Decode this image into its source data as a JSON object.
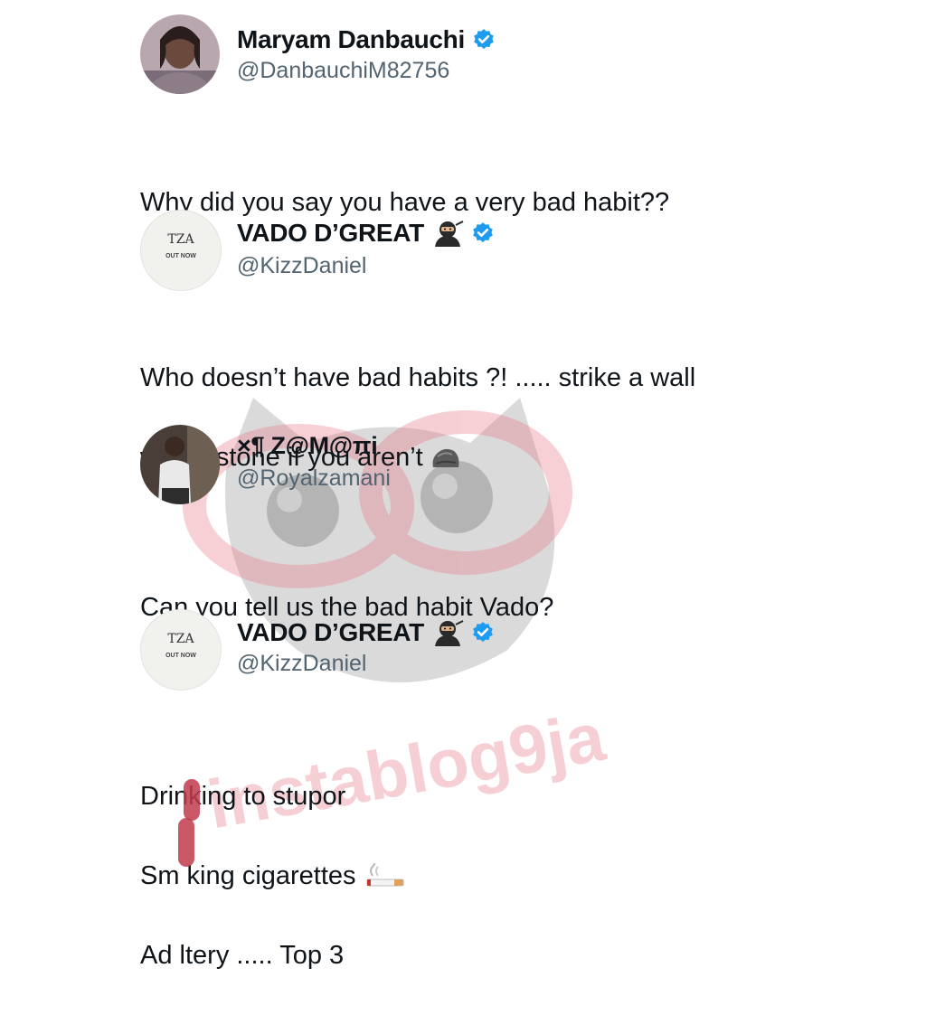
{
  "tweets": [
    {
      "name": "Maryam Danbauchi",
      "handle": "@DanbauchiM82756",
      "text_lines": [
        "Why did you say  you have a very bad habit??"
      ],
      "verified": true,
      "avatar": "profile-photo"
    },
    {
      "name": "VADO D’GREAT",
      "handle": "@KizzDaniel",
      "text_lines": [
        "Who doesn’t have bad habits ?! ..... strike a wall",
        "with a stone if you aren’t"
      ],
      "verified": true,
      "name_emoji": "ninja-emoji",
      "text_emoji": "rock-emoji",
      "avatar": "album-cover",
      "cover": {
        "title": "TZA",
        "subtitle": "OUT NOW"
      }
    },
    {
      "name": "×¶ Z@M@πi",
      "handle": "@Royalzamani",
      "text_lines": [
        "Can you tell us the bad habit Vado?"
      ],
      "verified": false,
      "avatar": "profile-photo"
    },
    {
      "name": "VADO D’GREAT",
      "handle": "@KizzDaniel",
      "text_lines": [
        "Drinking to stupor",
        "Sm  king  cigarettes",
        "Ad  ltery ..... Top 3"
      ],
      "verified": true,
      "name_emoji": "ninja-emoji",
      "text_emoji": "cigarette-emoji",
      "avatar": "album-cover",
      "cover": {
        "title": "TZA",
        "subtitle": "OUT NOW"
      }
    }
  ],
  "watermark": {
    "text": "instablog9ja",
    "colors": {
      "pink": "#e8788a",
      "gray": "#6b6b6b"
    }
  },
  "colors": {
    "verified": "#1d9bf0",
    "handle": "#536471",
    "text": "#0f1419",
    "redaction": "#c23b4b"
  }
}
